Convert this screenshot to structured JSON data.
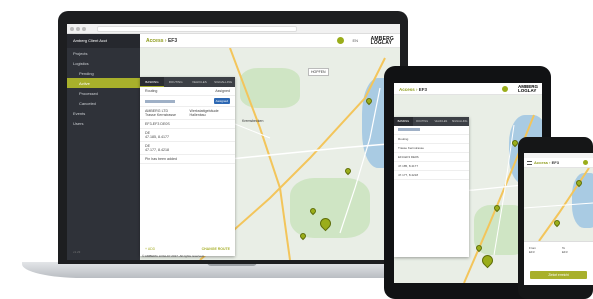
{
  "laptop": {
    "sidebar": {
      "user": "Amberg Client Acct",
      "items": [
        {
          "label": "Projects"
        },
        {
          "label": "Logistics"
        },
        {
          "label": "Pending"
        },
        {
          "label": "Active"
        },
        {
          "label": "Processed"
        },
        {
          "label": "Canceled"
        },
        {
          "label": "Events"
        },
        {
          "label": "Users"
        }
      ],
      "version": "v1.23"
    },
    "header": {
      "title_prefix": "Access",
      "title_value": "EF3",
      "lang": "EN",
      "brand_line1": "AMBERG",
      "brand_line2": "LOGLAY"
    },
    "panel": {
      "tabs": [
        "BASKING",
        "ROUTING",
        "VEHICLES",
        "SIGNALLING"
      ],
      "summary_label": "Routing",
      "summary_value": "Assigned",
      "badge": "Assigned",
      "addr1": "AMBERG LTD",
      "addr2": "Trasse Kernstrasse",
      "desc": "Werkstattgebäude Hallenbau",
      "ref": "EF3-EF3 DE0S",
      "field1_label": "DE",
      "field1_value": "47.185, 8.4177",
      "field2_label": "DE",
      "field2_value": "47.177, 8.4218",
      "field3": "Pin has been added",
      "go_label": "+ ADD",
      "change_label": "CHANGE ROUTE"
    },
    "map": {
      "tag1": "HOPFEN",
      "tag2": "Kremsbecken",
      "google": "Google"
    },
    "footer": "© AMBERG LOGLAY 2017. All rights reserved."
  },
  "tablet": {
    "header": {
      "title_prefix": "Access",
      "title_value": "EF3",
      "brand_line1": "AMBERG",
      "brand_line2": "LOGLAY"
    },
    "panel": {
      "tabs": [
        "BASKING",
        "ROUTING",
        "VEHICLES",
        "SIGNALLING"
      ],
      "rows": [
        "Routing",
        "Trasse Kernstrasse",
        "EF3-EF3 DE0S",
        "47.185, 8.4177",
        "47.177, 8.4218"
      ]
    }
  },
  "phone": {
    "header": {
      "title_prefix": "Access",
      "title_value": "EF3"
    },
    "card": {
      "col1_label": "From",
      "col1_value": "EF3",
      "col2_label": "To",
      "col2_value": "EF3",
      "button": "Zielort erreicht"
    }
  }
}
